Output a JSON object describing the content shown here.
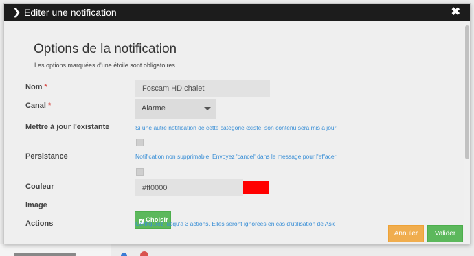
{
  "modal": {
    "title": "Editer une notification",
    "close_glyph": "✖",
    "heading": "Options de la notification",
    "subheading": "Les options marquées d'une étoile sont obligatoires."
  },
  "form": {
    "nom": {
      "label": "Nom",
      "required_mark": "*",
      "value": "Foscam HD chalet"
    },
    "canal": {
      "label": "Canal",
      "required_mark": "*",
      "value": "Alarme"
    },
    "mettre_a_jour": {
      "label": "Mettre à jour l'existante",
      "help": "Si une autre notification de cette catégorie existe, son contenu sera mis à jour",
      "checked": false
    },
    "persistance": {
      "label": "Persistance",
      "help": "Notification non supprimable. Envoyez 'cancel' dans le message pour l'effacer",
      "checked": false
    },
    "couleur": {
      "label": "Couleur",
      "value": "#ff0000",
      "swatch_color": "#ff0000"
    },
    "image": {
      "label": "Image",
      "button_label": "Choisir"
    },
    "actions": {
      "label": "Actions",
      "help": "Configurez jusqu'à 3 actions. Elles seront ignorées en cas d'utilisation de Ask"
    }
  },
  "footer": {
    "cancel_label": "Annuler",
    "ok_label": "Valider"
  },
  "colors": {
    "titlebar": "#1c1c1c",
    "cancel": "#f0ad4e",
    "ok": "#5cb85c",
    "help_text": "#3a8fd6",
    "required": "#d9534f"
  }
}
